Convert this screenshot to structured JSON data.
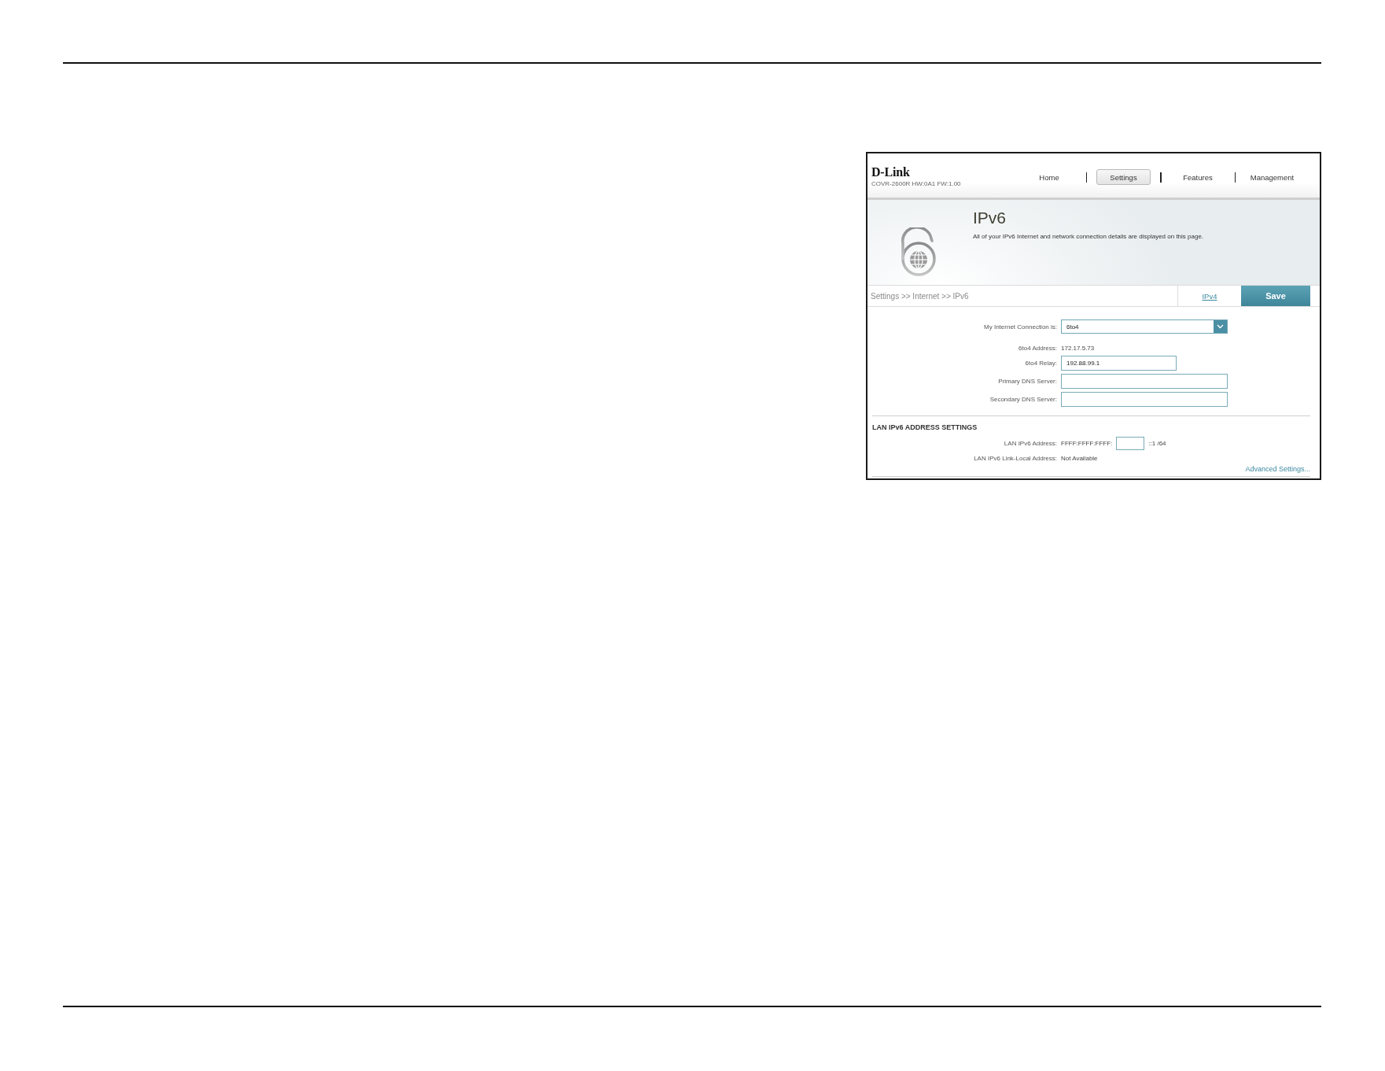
{
  "header": {
    "logo": "D-Link",
    "model": "COVR-2600R HW:0A1 FW:1.00",
    "nav": [
      {
        "label": "Home",
        "selected": false
      },
      {
        "label": "Settings",
        "selected": true
      },
      {
        "label": "Features",
        "selected": false
      },
      {
        "label": "Management",
        "selected": false
      }
    ]
  },
  "banner": {
    "title": "IPv6",
    "description": "All of your IPv6 Internet and network connection details are displayed on this page."
  },
  "toolbar": {
    "breadcrumb": "Settings >> Internet >> IPv6",
    "link": "IPv4",
    "button": "Save"
  },
  "connection_fields": [
    {
      "kind": "select",
      "label": "My Internet Connection is:",
      "value": "6to4"
    },
    {
      "kind": "readout",
      "label": "6to4 Address:",
      "value": "172.17.5.73"
    },
    {
      "kind": "input_short",
      "label": "6to4 Relay:",
      "value": "192.88.99.1"
    },
    {
      "kind": "input",
      "label": "Primary DNS Server:"
    },
    {
      "kind": "input",
      "label": "Secondary DNS Server:"
    }
  ],
  "lan_section": {
    "heading": "LAN IPv6 ADDRESS SETTINGS",
    "fields": [
      {
        "kind": "prefix",
        "label": "LAN IPv6 Address:",
        "prefix": "FFFF:FFFF:FFFF:",
        "suffix": "::1 /64"
      },
      {
        "kind": "readout",
        "label": "LAN IPv6 Link-Local Address:",
        "value": "Not Available"
      }
    ],
    "advanced_link": "Advanced Settings..."
  }
}
